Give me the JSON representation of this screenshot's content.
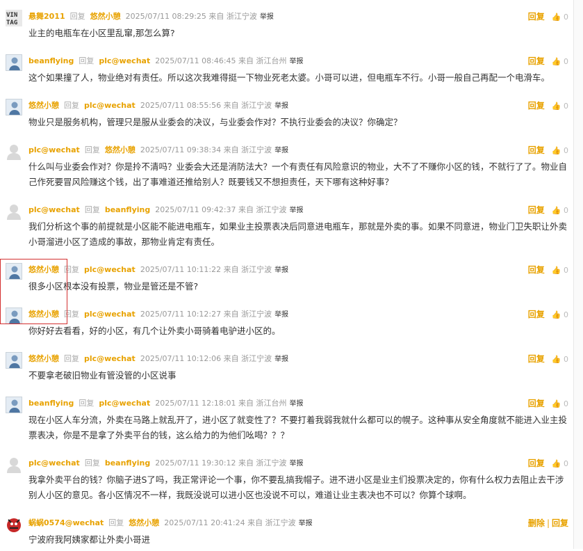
{
  "labels": {
    "reply": "回复",
    "from": "来自",
    "report": "举报",
    "reply_action": "回复",
    "delete_action": "删除",
    "reply_action_alt": "回复"
  },
  "comments": [
    {
      "user": "悬舞2011",
      "to": "悠然小憩",
      "time": "2025/07/11 08:29:25",
      "location": "浙江宁波",
      "likes": "0",
      "avatar": "vintage-avatar",
      "text": "业主的电瓶车在小区里乱窜,那怎么算?"
    },
    {
      "user": "beanflying",
      "to": "plc@wechat",
      "time": "2025/07/11 08:46:45",
      "location": "浙江台州",
      "likes": "0",
      "avatar": "person-avatar",
      "text": "这个如果撞了人，物业绝对有责任。所以这次我难得挺一下物业死老太婆。小哥可以进，但电瓶车不行。小哥一般自己再配一个电滑车。"
    },
    {
      "user": "悠然小憩",
      "to": "plc@wechat",
      "time": "2025/07/11 08:55:56",
      "location": "浙江宁波",
      "likes": "0",
      "avatar": "person-avatar",
      "text": "物业只是服务机构，管理只是服从业委会的决议，与业委会作对？不执行业委会的决议？你确定？"
    },
    {
      "user": "plc@wechat",
      "to": "悠然小憩",
      "time": "2025/07/11 09:38:34",
      "location": "浙江宁波",
      "likes": "0",
      "avatar": "default-avatar",
      "text": "什么叫与业委会作对？你是拎不清吗？业委会大还是消防法大？一个有责任有风险意识的物业，大不了不赚你小区的钱，不就行了了。物业自己作死要冒风险赚这个钱，出了事难道还推给别人？既要钱又不想担责任，天下哪有这种好事？"
    },
    {
      "user": "plc@wechat",
      "to": "beanflying",
      "time": "2025/07/11 09:42:37",
      "location": "浙江宁波",
      "likes": "0",
      "avatar": "default-avatar",
      "text": "我们分析这个事的前提就是小区能不能进电瓶车，如果业主投票表决后同意进电瓶车，那就是外卖的事。如果不同意进，物业门卫失职让外卖小哥溜进小区了造成的事故，那物业肯定有责任。"
    },
    {
      "user": "悠然小憩",
      "to": "plc@wechat",
      "time": "2025/07/11 10:11:22",
      "location": "浙江宁波",
      "likes": "0",
      "avatar": "person-avatar",
      "text": "很多小区根本没有投票，物业是管还是不管?"
    },
    {
      "user": "悠然小憩",
      "to": "plc@wechat",
      "time": "2025/07/11 10:12:27",
      "location": "浙江宁波",
      "likes": "0",
      "avatar": "person-avatar",
      "text": "你好好去看看，好的小区，有几个让外卖小哥骑着电驴进小区的。"
    },
    {
      "user": "悠然小憩",
      "to": "plc@wechat",
      "time": "2025/07/11 10:12:06",
      "location": "浙江宁波",
      "likes": "0",
      "avatar": "person-avatar",
      "text": "不要拿老破旧物业有管没管的小区说事"
    },
    {
      "user": "beanflying",
      "to": "plc@wechat",
      "time": "2025/07/11 12:18:01",
      "location": "浙江台州",
      "likes": "0",
      "avatar": "person-avatar",
      "text": "现在小区人车分流，外卖在马路上就乱开了，进小区了就变性了？不要打着我弱我就什么都可以的幌子。这种事从安全角度就不能进入业主投票表决，你是不是拿了外卖平台的钱，这么给力的为他们吆喝？？？"
    },
    {
      "user": "plc@wechat",
      "to": "beanflying",
      "time": "2025/07/11 19:30:12",
      "location": "浙江宁波",
      "likes": "0",
      "avatar": "default-avatar",
      "text": "我拿外卖平台的钱？你脑子进S了吗，我正常评论一个事，你不要乱搞我帽子。进不进小区是业主们投票决定的，你有什么权力去阻止去干涉别人小区的意见。各小区情况不一样，我既没说可以进小区也没说不可以，难道让业主表决也不可以？你算个球啊。"
    },
    {
      "user": "蜗蜗0574@wechat",
      "to": "悠然小憩",
      "time": "2025/07/11 20:41:24",
      "location": "浙江宁波",
      "likes": "",
      "avatar": "red-avatar",
      "text": "宁波府我阿姨家都让外卖小哥进"
    }
  ]
}
